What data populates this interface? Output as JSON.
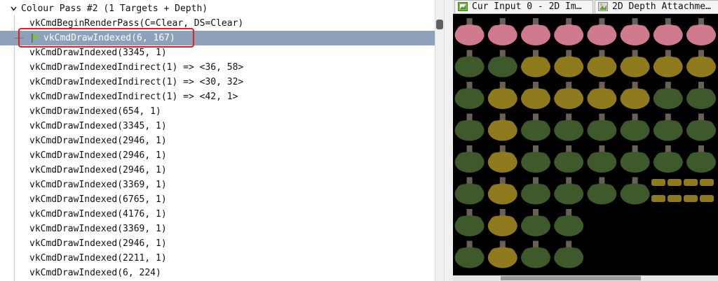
{
  "event_list": {
    "header": "Colour Pass #2 (1 Targets + Depth)",
    "rows": [
      "vkCmdBeginRenderPass(C=Clear, DS=Clear)",
      "vkCmdDrawIndexed(6, 167)",
      "vkCmdDrawIndexed(3345, 1)",
      "vkCmdDrawIndexedIndirect(1) => <36, 58>",
      "vkCmdDrawIndexedIndirect(1) => <30, 32>",
      "vkCmdDrawIndexedIndirect(1) => <42, 1>",
      "vkCmdDrawIndexed(654, 1)",
      "vkCmdDrawIndexed(3345, 1)",
      "vkCmdDrawIndexed(2946, 1)",
      "vkCmdDrawIndexed(2946, 1)",
      "vkCmdDrawIndexed(2946, 1)",
      "vkCmdDrawIndexed(3369, 1)",
      "vkCmdDrawIndexed(6765, 1)",
      "vkCmdDrawIndexed(4176, 1)",
      "vkCmdDrawIndexed(3369, 1)",
      "vkCmdDrawIndexed(2946, 1)",
      "vkCmdDrawIndexed(2211, 1)",
      "vkCmdDrawIndexed(6, 224)"
    ],
    "selected_row": 1
  },
  "texture_viewer": {
    "tabs": [
      {
        "label": "Cur Input 0 - 2D Im…",
        "icon": "image-icon"
      },
      {
        "label": "2D Depth Attachme…",
        "icon": "image-icon"
      }
    ]
  },
  "colors": {
    "selection": "#8ea1bb",
    "highlight_box": "#e02020",
    "pink_foliage": "#d07a8e",
    "yellow_foliage": "#8f7a1e",
    "green_foliage": "#3f5a2a",
    "trunk": "#6a6058"
  }
}
